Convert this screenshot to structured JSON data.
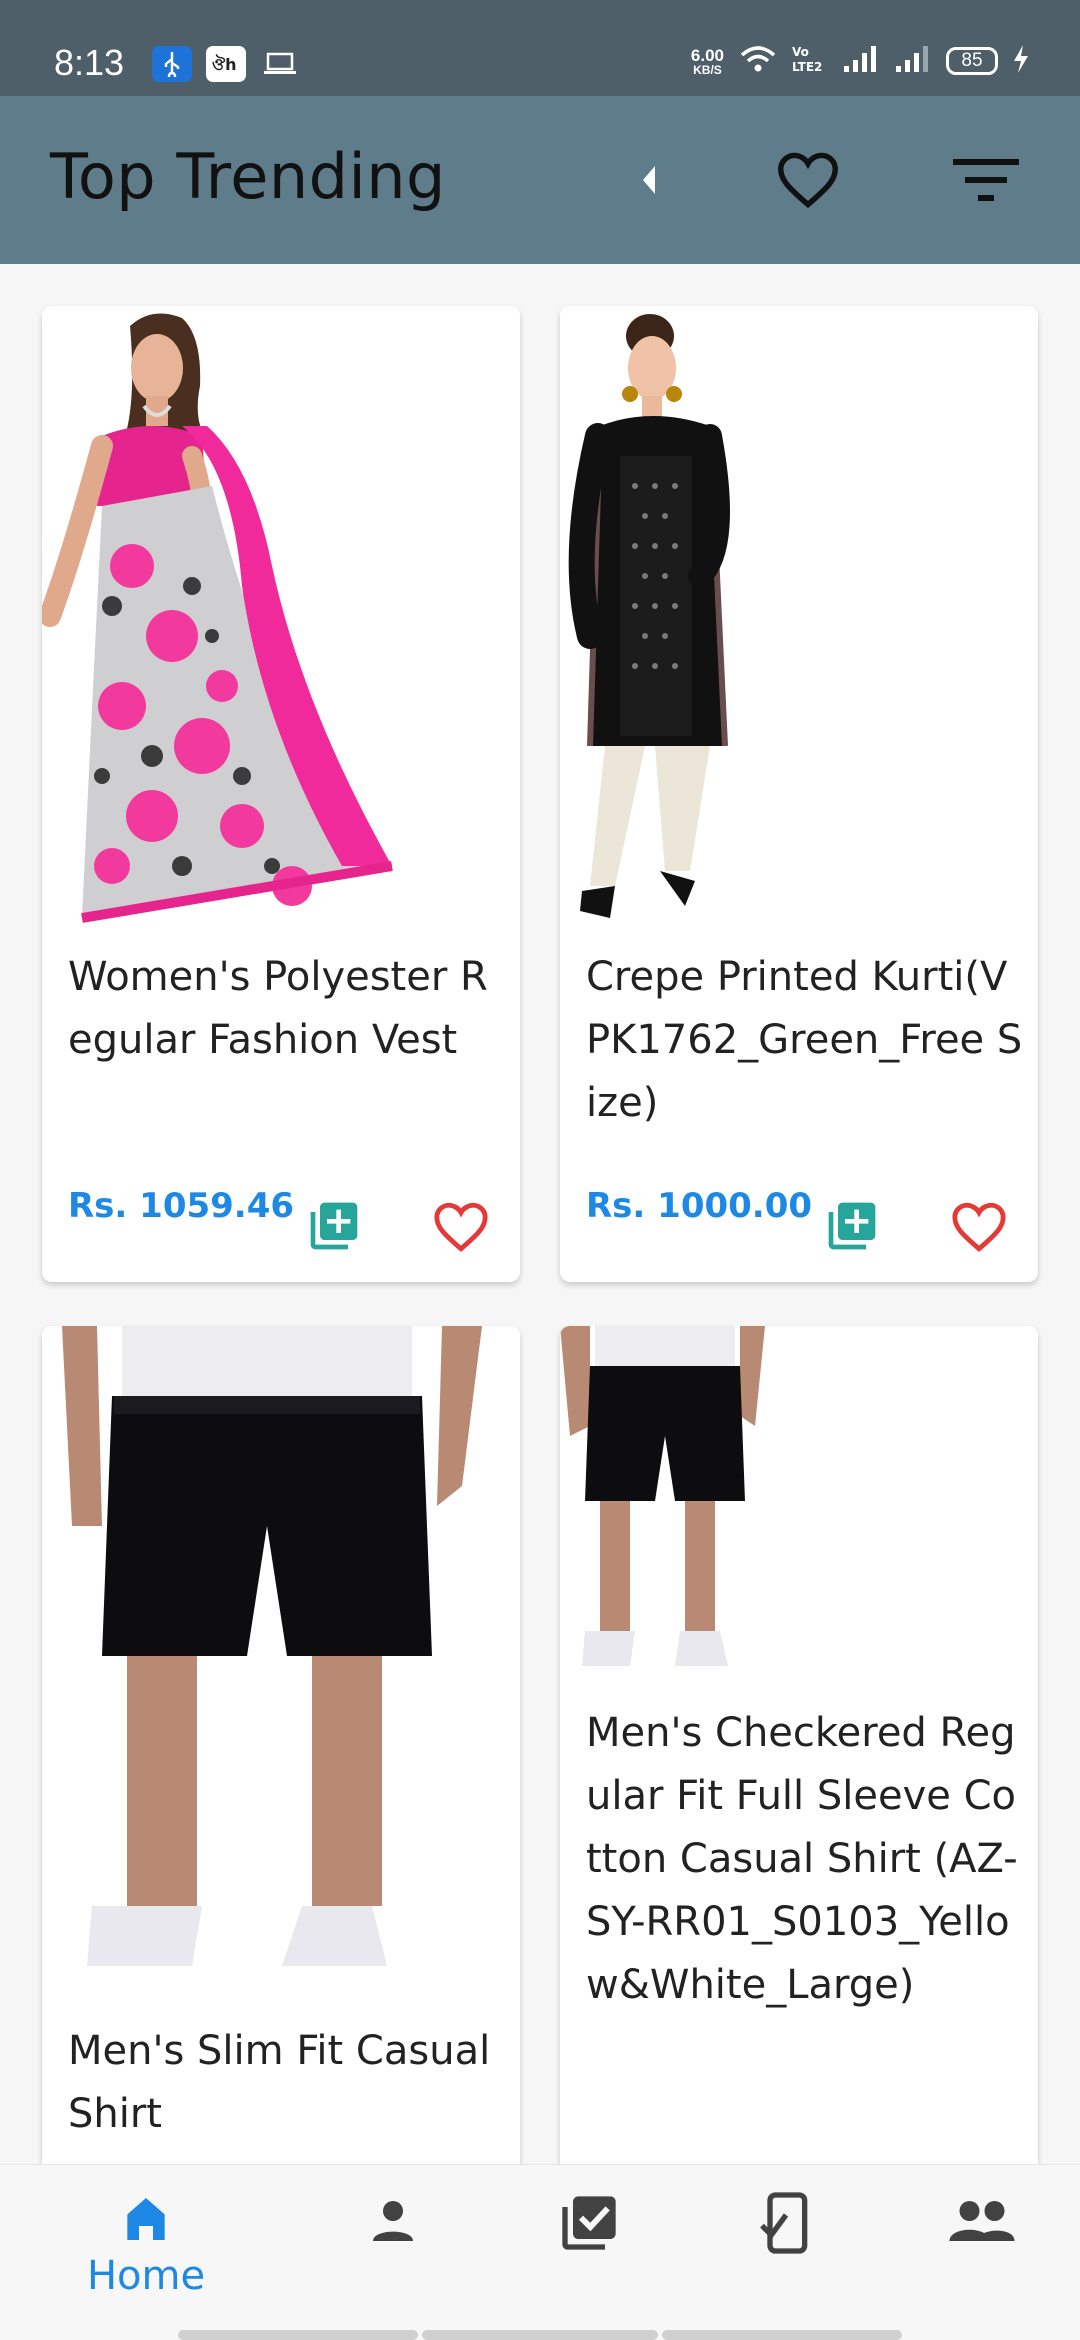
{
  "status_bar": {
    "time": "8:13",
    "net_speed_value": "6.00",
    "net_speed_unit": "KB/S",
    "volte": "Vo LTE2",
    "battery": "85"
  },
  "app_bar": {
    "title": "Top Trending"
  },
  "products": [
    {
      "title": "Women's Polyester Regular Fashion Vest",
      "price": "Rs. 1059.46"
    },
    {
      "title": "Crepe Printed Kurti(VPK1762_Green_Free Size)",
      "price": "Rs. 1000.00"
    },
    {
      "title": "Men's Slim Fit Casual Shirt",
      "price": ""
    },
    {
      "title": "Men's Checkered Regular Fit Full Sleeve Cotton Casual Shirt (AZ-SY-RR01_S0103_Yellow&White_Large)",
      "price": ""
    }
  ],
  "bottom_nav": {
    "home_label": "Home"
  },
  "colors": {
    "status_bar": "#4e5f69",
    "app_bar": "#5f7c8a",
    "price": "#1e88e5",
    "cart_icon": "#26a69a",
    "fav_icon": "#e53935",
    "nav_active": "#1e88e5",
    "nav_inactive": "#424242"
  }
}
